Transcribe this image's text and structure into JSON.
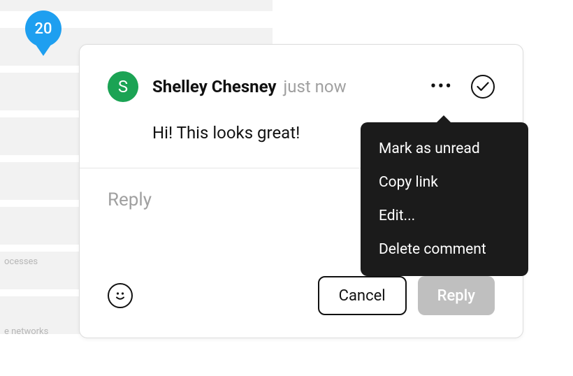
{
  "pin": {
    "number": "20"
  },
  "background": {
    "label1": "ocesses",
    "label2": "e networks"
  },
  "comment": {
    "avatar_initial": "S",
    "author": "Shelley Chesney",
    "timestamp": "just now",
    "body": "Hi! This looks great!"
  },
  "reply": {
    "placeholder": "Reply"
  },
  "buttons": {
    "cancel": "Cancel",
    "reply": "Reply"
  },
  "menu": {
    "items": [
      "Mark as unread",
      "Copy link",
      "Edit...",
      "Delete comment"
    ]
  }
}
